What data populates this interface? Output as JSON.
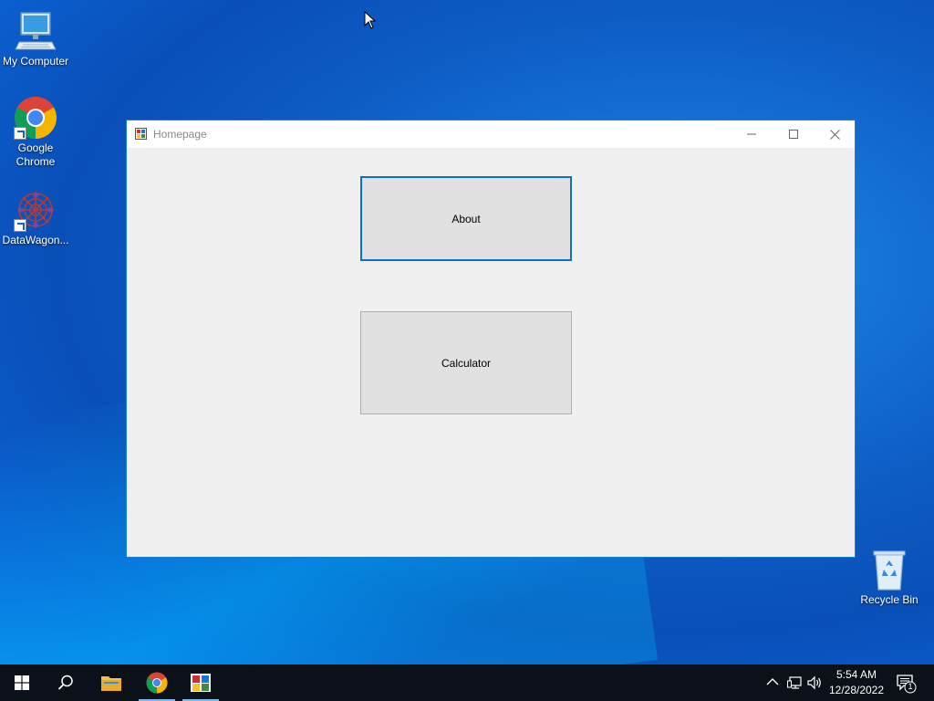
{
  "desktop": {
    "icons": [
      {
        "label": "My Computer",
        "icon": "computer-icon"
      },
      {
        "label": "Google Chrome",
        "icon": "chrome-icon"
      },
      {
        "label": "DataWagon...",
        "icon": "datawagon-icon"
      },
      {
        "label": "Recycle Bin",
        "icon": "recycle-bin-icon"
      }
    ]
  },
  "window": {
    "title": "Homepage",
    "buttons": {
      "about": "About",
      "calculator": "Calculator"
    }
  },
  "taskbar": {
    "time": "5:54 AM",
    "date": "12/28/2022",
    "notification_count": "1"
  },
  "colors": {
    "accent": "#0b6fd0",
    "taskbar": "#0c1018",
    "window_bg": "#f0f0f0",
    "button_bg": "#e1e1e1"
  }
}
